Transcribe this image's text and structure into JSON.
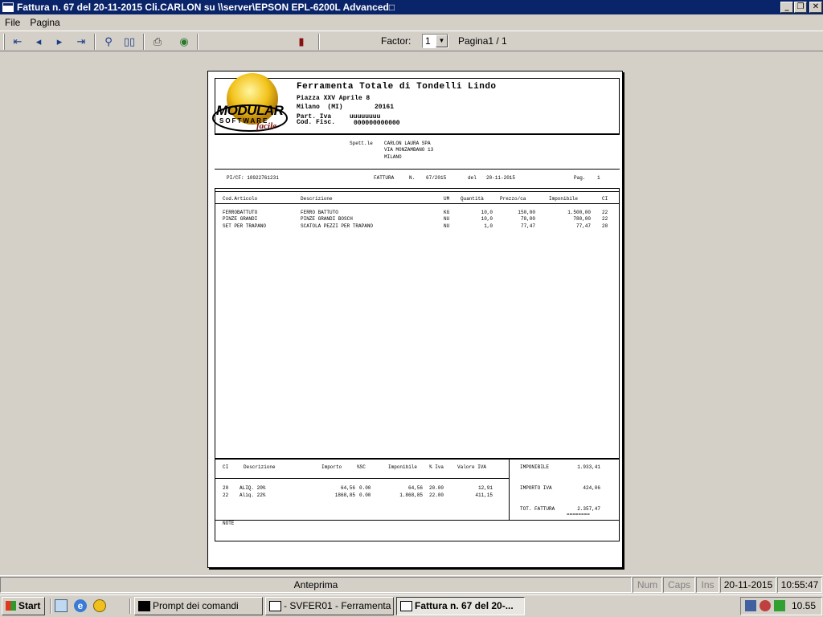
{
  "window": {
    "title": "Fattura n.  67 del 20-11-2015 Cli.CARLON su \\\\server\\EPSON EPL-6200L Advanced□"
  },
  "menu": {
    "file": "File",
    "pagina": "Pagina"
  },
  "toolbar": {
    "factor_label": "Factor:",
    "factor_value": "1",
    "page_indicator": "Pagina1 / 1"
  },
  "logo": {
    "line1": "MODULAR",
    "line2": "SOFTWARE",
    "line3": "facile"
  },
  "company": {
    "name": "Ferramenta Totale di Tondelli Lindo",
    "address": "Piazza XXV Aprile 8",
    "city": "Milano  (MI)",
    "zip": "20161",
    "piva_label": "Part. Iva",
    "piva": "uuuuuuuu",
    "cf_label": "Cod. Fisc.",
    "cf": "000000000000"
  },
  "customer": {
    "label": "Spett.le",
    "name": "CARLON LAURA SPA",
    "street": "VIA MONZAMBANO 13",
    "city": "MILANO"
  },
  "invoice": {
    "picf": "PI/CF: 10922761231",
    "doc_label": "FATTURA",
    "num_label": "N.",
    "number": "67/2015",
    "date_label": "del",
    "date": "20-11-2015",
    "page_label": "Pag.",
    "page": "1"
  },
  "items_header": {
    "cod": "Cod.Articolo",
    "desc": "Descrizione",
    "um": "UM",
    "qty": "Quantità",
    "price": "Prezzo/ca",
    "taxable": "Imponibile",
    "ci": "CI"
  },
  "items": [
    {
      "cod": "FERROBATTUTO",
      "desc": "FERRO BATTUTO",
      "um": "KG",
      "qty": "10,0",
      "price": "150,00",
      "taxable": "1.500,00",
      "ci": "22"
    },
    {
      "cod": "PINZE GRANDI",
      "desc": "PINZE GRANDI BOSCH",
      "um": "NU",
      "qty": "10,0",
      "price": "78,00",
      "taxable": "780,00",
      "ci": "22"
    },
    {
      "cod": "SET PER TRAPANO",
      "desc": "SCATOLA PEZZI PER TRAPANO",
      "um": "NU",
      "qty": "1,0",
      "price": "77,47",
      "taxable": "77,47",
      "ci": "20"
    }
  ],
  "vat_header": {
    "ci": "CI",
    "desc": "Descrizione",
    "importo": "Importo",
    "sc": "%SC",
    "taxable": "Imponibile",
    "iva": "% Iva",
    "valore": "Valore IVA"
  },
  "vat_rows": [
    {
      "ci": "20",
      "desc": "ALIQ. 20%",
      "importo": "64,56",
      "sc": "0.00",
      "taxable": "64,56",
      "iva": "20.00",
      "valore": "12,91"
    },
    {
      "ci": "22",
      "desc": "Aliq. 22%",
      "importo": "1868,85",
      "sc": "0.00",
      "taxable": "1.868,85",
      "iva": "22.00",
      "valore": "411,15"
    }
  ],
  "totals": {
    "imponibile_label": "IMPONIBILE",
    "imponibile": "1.933,41",
    "iva_label": "IMPORTO IVA",
    "iva": "424,06",
    "total_label": "TOT. FATTURA",
    "total": "2.357,47",
    "underline": "========"
  },
  "note_label": "NOTE",
  "statusbar": {
    "mode": "Anteprima",
    "num": "Num",
    "caps": "Caps",
    "ins": "Ins",
    "date": "20-11-2015",
    "time": "10:55:47"
  },
  "taskbar": {
    "start": "Start",
    "tasks": [
      "Prompt dei comandi",
      "- SVFER01 - Ferramenta ...",
      "Fattura n.  67 del 20-..."
    ],
    "clock": "10.55"
  }
}
